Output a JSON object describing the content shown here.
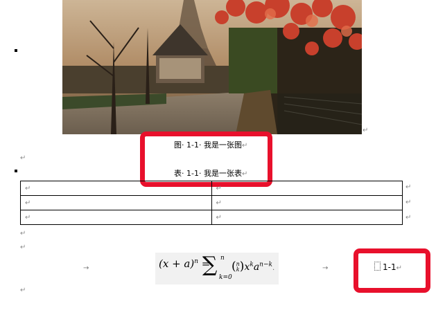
{
  "figure_caption": "图· 1-1· 我是一张图",
  "table_caption": "表· 1-1· 我是一张表",
  "paragraph_mark": "↵",
  "tab_arrow": "→",
  "table": {
    "rows": [
      [
        "↵",
        "↵"
      ],
      [
        "↵",
        "↵"
      ],
      [
        "↵",
        "↵"
      ]
    ],
    "row_end_mark": "↵"
  },
  "equation": {
    "lhs": "(x + a)",
    "lhs_exp": "n",
    "eq": " = ",
    "sum_symbol": "∑",
    "sum_upper": "n",
    "sum_lower": "k=0",
    "binom_top": "n",
    "binom_bottom": "k",
    "term": "x",
    "term_exp": "k",
    "term2": "a",
    "term2_exp": "n−k",
    "end_mark": "."
  },
  "equation_number": "1-1",
  "highlight_color": "#e8102c",
  "photo_description_icon": "eiffel-park-photo"
}
